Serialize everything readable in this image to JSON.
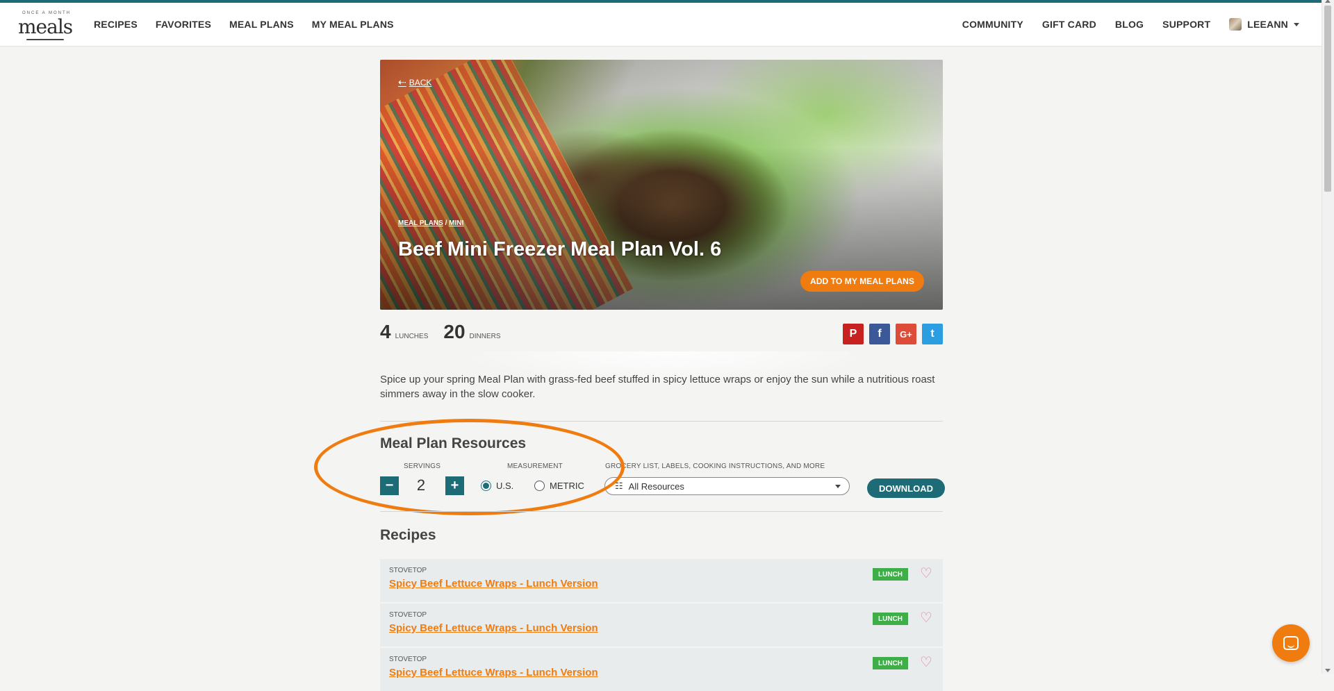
{
  "logo": {
    "tagline": "ONCE A MONTH",
    "word": "meals"
  },
  "nav_left": [
    {
      "label": "RECIPES"
    },
    {
      "label": "FAVORITES"
    },
    {
      "label": "MEAL PLANS"
    },
    {
      "label": "MY MEAL PLANS"
    }
  ],
  "nav_right": [
    {
      "label": "COMMUNITY"
    },
    {
      "label": "GIFT CARD"
    },
    {
      "label": "BLOG"
    },
    {
      "label": "SUPPORT"
    }
  ],
  "user": {
    "name": "LEEANN"
  },
  "hero": {
    "back": "BACK",
    "breadcrumb": {
      "a": "MEAL PLANS",
      "sep": "/",
      "b": "MINI"
    },
    "title": "Beef Mini Freezer Meal Plan Vol. 6",
    "add_button": "ADD TO MY MEAL PLANS"
  },
  "counts": {
    "lunches_num": "4",
    "lunches_label": "LUNCHES",
    "dinners_num": "20",
    "dinners_label": "DINNERS"
  },
  "social": {
    "pinterest": "P",
    "facebook": "f",
    "google": "G+",
    "twitter": "t"
  },
  "description": "Spice up your spring Meal Plan with grass-fed beef stuffed in spicy lettuce wraps or enjoy the sun while a nutritious roast simmers away in the slow cooker.",
  "resources": {
    "title": "Meal Plan Resources",
    "servings_label": "SERVINGS",
    "servings_value": "2",
    "minus": "−",
    "plus": "+",
    "measurement_label": "MEASUREMENT",
    "us_label": "U.S.",
    "metric_label": "METRIC",
    "selected_measurement": "U.S.",
    "resource_label": "GROCERY LIST, LABELS, COOKING INSTRUCTIONS, AND MORE",
    "resource_value": "All Resources",
    "download": "DOWNLOAD"
  },
  "recipes": {
    "title": "Recipes",
    "items": [
      {
        "method": "STOVETOP",
        "name": "Spicy Beef Lettuce Wraps - Lunch Version",
        "tag": "LUNCH"
      },
      {
        "method": "STOVETOP",
        "name": "Spicy Beef Lettuce Wraps - Lunch Version",
        "tag": "LUNCH"
      },
      {
        "method": "STOVETOP",
        "name": "Spicy Beef Lettuce Wraps - Lunch Version",
        "tag": "LUNCH"
      }
    ]
  },
  "colors": {
    "teal": "#1d6b76",
    "orange": "#f07c10",
    "green_tag": "#3fae49",
    "heart": "#e77a99"
  }
}
